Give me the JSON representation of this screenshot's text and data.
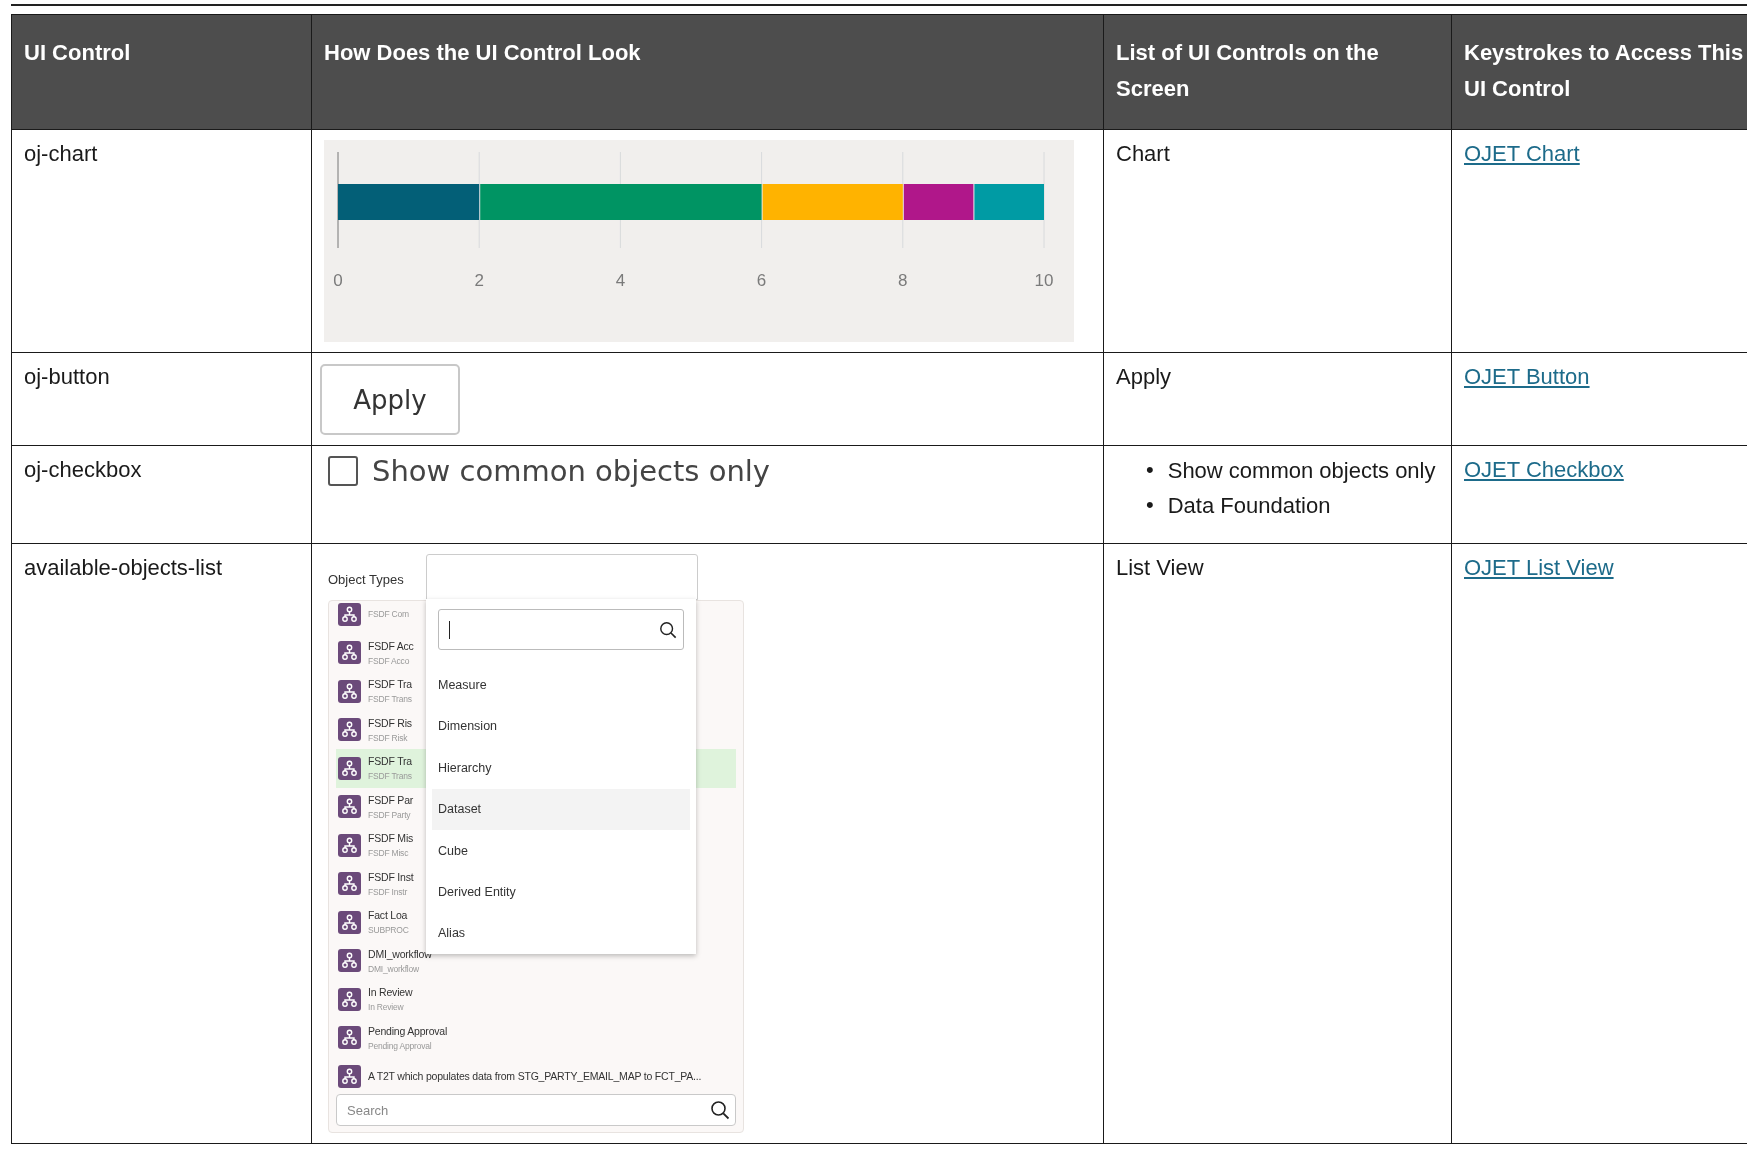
{
  "table": {
    "columns": [
      "UI Control",
      "How Does the UI Control Look",
      "List of UI Controls on the Screen",
      "Keystrokes to Access This UI Control"
    ],
    "rows": [
      {
        "kind": "chart",
        "control": "oj-chart",
        "chart_data": {
          "type": "bar",
          "orientation": "horizontal",
          "stacked": true,
          "grid": true,
          "xlim": [
            0,
            10
          ],
          "xticks": [
            0,
            2,
            4,
            6,
            8,
            10
          ],
          "series": [
            {
              "color": "#035f77",
              "values": [
                2
              ]
            },
            {
              "color": "#009463",
              "values": [
                4
              ]
            },
            {
              "color": "#ffb300",
              "values": [
                2
              ]
            },
            {
              "color": "#b0178a",
              "values": [
                1
              ]
            },
            {
              "color": "#009ba4",
              "values": [
                1
              ]
            }
          ]
        },
        "screen_controls": [
          "Chart"
        ],
        "link": "OJET Chart"
      },
      {
        "kind": "button",
        "control": "oj-button",
        "button_label": "Apply",
        "screen_controls": [
          "Apply"
        ],
        "link": "OJET Button"
      },
      {
        "kind": "checkbox",
        "control": "oj-checkbox",
        "checkbox": {
          "label": "Show common objects only",
          "checked": false
        },
        "screen_controls": [
          "Show common objects only",
          "Data Foundation"
        ],
        "bullet": "•",
        "link": "OJET Checkbox"
      },
      {
        "kind": "listview",
        "control": "available-objects-list",
        "listview": {
          "label": "Object Types",
          "dropdown_options": [
            {
              "label": "Measure",
              "selected": false
            },
            {
              "label": "Dimension",
              "selected": false
            },
            {
              "label": "Hierarchy",
              "selected": false
            },
            {
              "label": "Dataset",
              "selected": true
            },
            {
              "label": "Cube",
              "selected": false
            },
            {
              "label": "Derived Entity",
              "selected": false
            },
            {
              "label": "Alias",
              "selected": false
            }
          ],
          "items": [
            {
              "subtitle": "FSDF Com",
              "selected": false
            },
            {
              "title": "FSDF Acc",
              "subtitle": "FSDF Acco",
              "selected": false
            },
            {
              "title": "FSDF Tra",
              "subtitle": "FSDF Trans",
              "selected": false
            },
            {
              "title": "FSDF Ris",
              "subtitle": "FSDF Risk",
              "selected": false
            },
            {
              "title": "FSDF Tra",
              "subtitle": "FSDF Trans",
              "selected": true
            },
            {
              "title": "FSDF Par",
              "subtitle": "FSDF Party",
              "selected": false
            },
            {
              "title": "FSDF Mis",
              "subtitle": "FSDF Misc",
              "selected": false
            },
            {
              "title": "FSDF Inst",
              "subtitle": "FSDF Instr",
              "selected": false
            },
            {
              "title": "Fact Loa",
              "subtitle": "SUBPROC",
              "selected": false
            },
            {
              "title": "DMI_workflow",
              "subtitle": "DMI_workflow",
              "selected": false
            },
            {
              "title": "In Review",
              "subtitle": "In Review",
              "selected": false
            },
            {
              "title": "Pending Approval",
              "subtitle": "Pending Approval",
              "selected": false
            },
            {
              "title": "A T2T which populates data from STG_PARTY_EMAIL_MAP to FCT_PA...",
              "selected": false
            }
          ],
          "search_placeholder": "Search"
        },
        "screen_controls": [
          "List View"
        ],
        "link": "OJET List View"
      }
    ]
  }
}
